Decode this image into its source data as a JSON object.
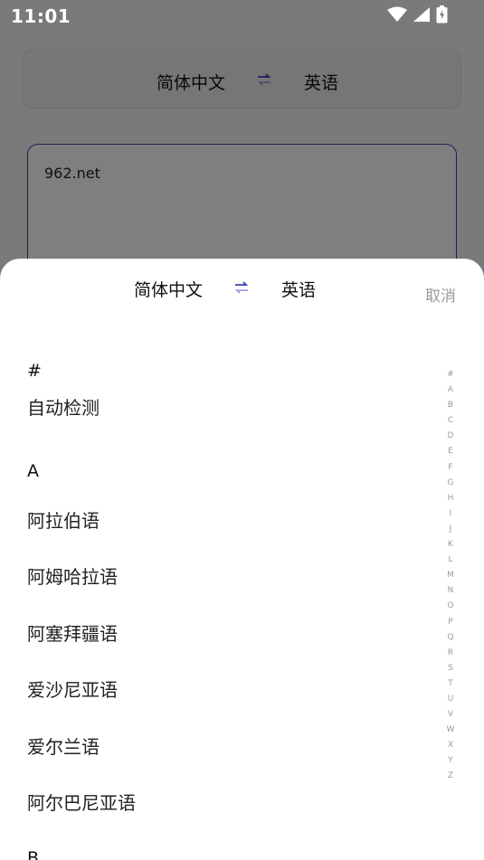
{
  "status_bar": {
    "time": "11:01"
  },
  "background": {
    "source_language": "简体中文",
    "target_language": "英语",
    "input_text": "962.net"
  },
  "sheet": {
    "source_language": "简体中文",
    "target_language": "英语",
    "cancel_label": "取消",
    "sections": [
      {
        "header": "#",
        "items": [
          "自动检测"
        ]
      },
      {
        "header": "A",
        "items": [
          "阿拉伯语",
          "阿姆哈拉语",
          "阿塞拜疆语",
          "爱沙尼亚语",
          "爱尔兰语",
          "阿尔巴尼亚语"
        ]
      },
      {
        "header": "B",
        "items": []
      }
    ]
  },
  "index_letters": [
    "#",
    "A",
    "B",
    "C",
    "D",
    "E",
    "F",
    "G",
    "H",
    "I",
    "J",
    "K",
    "L",
    "M",
    "N",
    "O",
    "P",
    "Q",
    "R",
    "S",
    "T",
    "U",
    "V",
    "W",
    "X",
    "Y",
    "Z"
  ],
  "colors": {
    "accent": "#3a3fb0",
    "swap_top": "#3a3fb0",
    "swap_bottom": "#9aa0e6",
    "muted": "#9a9a9a"
  }
}
